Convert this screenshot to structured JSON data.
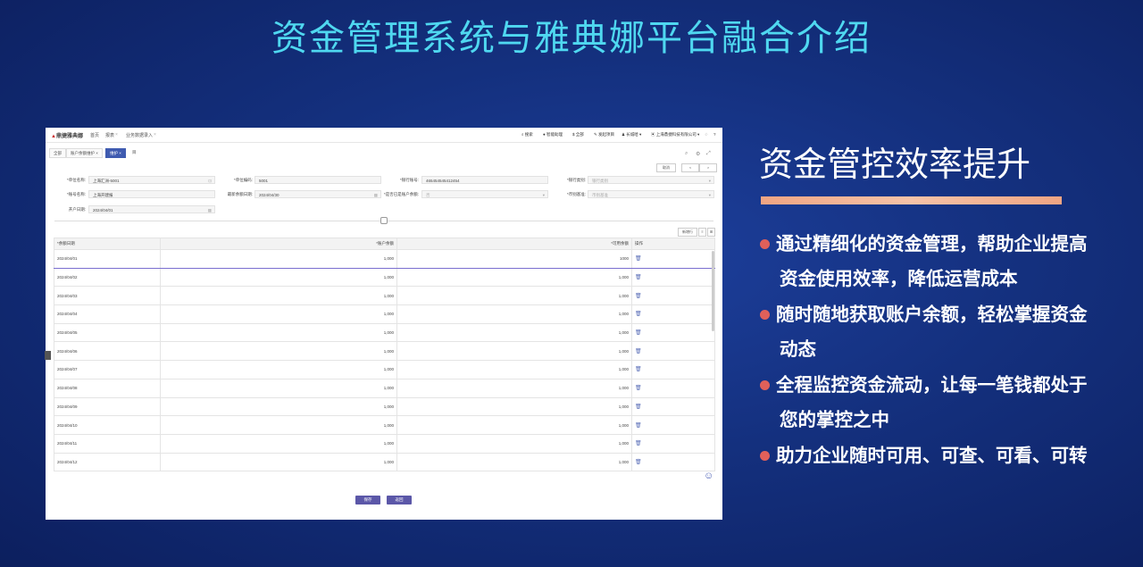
{
  "slide": {
    "title": "资金管理系统与雅典娜平台融合介绍",
    "right_title": "资金管控效率提升",
    "bullets": [
      [
        "通过精细化的资金管理，帮助企业提高",
        "资金使用效率，降低运营成本"
      ],
      [
        "随时随地获取账户余额，轻松掌握资金",
        "动态"
      ],
      [
        "全程监控资金流动，让每一笔钱都处于",
        "您的掌控之中"
      ],
      [
        "助力企业随时可用、可查、可看、可转",
        ""
      ]
    ],
    "bullet_color": "#e0605a",
    "title_color": "#4fd8f0"
  },
  "app": {
    "logo_a": "鼎捷",
    "logo_b": "雅典娜",
    "nav": [
      "首页",
      "报表",
      "业务数据录入"
    ],
    "topright": [
      "搜索",
      "智能助理",
      "全部",
      "发起项目",
      "长城哈",
      "上海鼎捷科技有限公司"
    ],
    "tabs": [
      "全部",
      "账户余额维护",
      "维护",
      "目"
    ],
    "actions": {
      "save": "取消",
      "prev": "<",
      "next": ">"
    },
    "form": {
      "bank_company_label": "*单位名称:",
      "bank_company": "上海汇洲-5001",
      "unit_code_label": "*单位编码:",
      "unit_code": "5001",
      "account_label": "*银行账号:",
      "account": "465454545412454",
      "bank_type_label": "*银行类别:",
      "bank_type": "银行类别",
      "account_name_label": "*账号名称:",
      "account_name": "上海开建报",
      "last_date_label": "最新余额日期:",
      "last_date": "2024/04/30",
      "is_record_label": "*是否已是账户余额:",
      "is_record": "否",
      "currency_label": "*币别基准:",
      "currency": "币别基准",
      "open_date_label": "开户日期:",
      "open_date": "2024/04/01"
    },
    "add_row": "新增行",
    "table": {
      "headers": [
        "*余额日期",
        "*账户余额",
        "*可用余额",
        "操作"
      ],
      "rows": [
        [
          "2024/04/01",
          "1,000",
          "1000"
        ],
        [
          "2024/04/02",
          "1,000",
          "1,000"
        ],
        [
          "2024/04/03",
          "1,000",
          "1,000"
        ],
        [
          "2024/04/04",
          "1,000",
          "1,000"
        ],
        [
          "2024/04/05",
          "1,000",
          "1,000"
        ],
        [
          "2024/04/06",
          "1,000",
          "1,000"
        ],
        [
          "2024/04/07",
          "1,000",
          "1,000"
        ],
        [
          "2024/04/08",
          "1,000",
          "1,000"
        ],
        [
          "2024/04/09",
          "1,000",
          "1,000"
        ],
        [
          "2024/04/10",
          "1,000",
          "1,000"
        ],
        [
          "2024/04/11",
          "1,000",
          "1,000"
        ],
        [
          "2024/04/12",
          "1,000",
          "1,000"
        ]
      ]
    },
    "footer": {
      "save": "保存",
      "cancel": "返回"
    }
  }
}
